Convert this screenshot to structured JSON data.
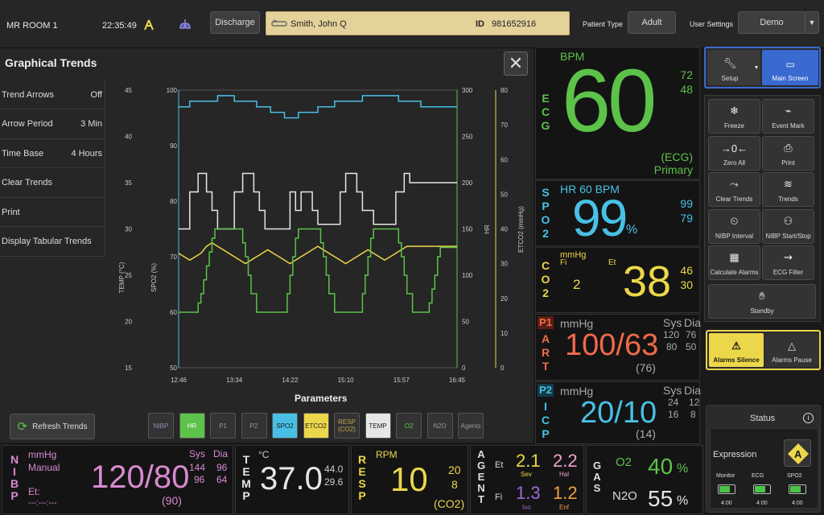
{
  "topbar": {
    "room": "MR ROOM 1",
    "time": "22:35:49",
    "discharge_label": "Discharge",
    "patient_name": "Smith, John Q",
    "id_label": "ID",
    "patient_id": "981652916",
    "patient_type_label": "Patient Type",
    "patient_type_value": "Adult",
    "user_settings_label": "User Settings",
    "user_settings_value": "Demo"
  },
  "trends": {
    "title": "Graphical Trends",
    "menu": [
      {
        "label": "Trend Arrows",
        "value": "Off"
      },
      {
        "label": "Arrow Period",
        "value": "3 Min"
      },
      {
        "label": "Time Base",
        "value": "4 Hours"
      },
      {
        "label": "Clear Trends",
        "value": ""
      },
      {
        "label": "Print",
        "value": ""
      },
      {
        "label": "Display Tabular Trends",
        "value": ""
      }
    ],
    "parameters_label": "Parameters",
    "refresh_label": "Refresh Trends",
    "params": [
      {
        "label": "NIBP",
        "bg": "#333333",
        "fg": "#a08ab0"
      },
      {
        "label": "HR",
        "bg": "#5cc24a",
        "fg": "#ffffff"
      },
      {
        "label": "P1",
        "bg": "#333333",
        "fg": "#999999"
      },
      {
        "label": "P2",
        "bg": "#333333",
        "fg": "#999999"
      },
      {
        "label": "SPO2",
        "bg": "#48c0e6",
        "fg": "#1a1a1a"
      },
      {
        "label": "ETCO2",
        "bg": "#ecd74a",
        "fg": "#1a1a1a"
      },
      {
        "label": "RESP (CO2)",
        "bg": "#333333",
        "fg": "#c2a84a"
      },
      {
        "label": "TEMP",
        "bg": "#e6e6e6",
        "fg": "#1a1a1a"
      },
      {
        "label": "O2",
        "bg": "#333333",
        "fg": "#5cc24a"
      },
      {
        "label": "N2O",
        "bg": "#333333",
        "fg": "#999999"
      },
      {
        "label": "Agents",
        "bg": "#333333",
        "fg": "#999999"
      }
    ]
  },
  "chart_data": {
    "type": "line",
    "x_ticks": [
      "12:46",
      "13:34",
      "14:22",
      "15:10",
      "15:57",
      "16:45"
    ],
    "axes": {
      "temp": {
        "label": "TEMP (°C)",
        "range": [
          15,
          45
        ],
        "ticks": [
          "15",
          "20",
          "25",
          "30",
          "35",
          "40",
          "45"
        ]
      },
      "spo2": {
        "label": "SPO2 (%)",
        "range": [
          50,
          100
        ],
        "ticks": [
          "50",
          "60",
          "70",
          "80",
          "90",
          "100"
        ]
      },
      "hr": {
        "label": "HR",
        "range": [
          0,
          300
        ],
        "ticks": [
          "0",
          "50",
          "100",
          "150",
          "200",
          "250",
          "300"
        ]
      },
      "etco2": {
        "label": "ETCO2 (mmHg)",
        "range": [
          0,
          80
        ],
        "ticks": [
          "0",
          "10",
          "20",
          "30",
          "40",
          "50",
          "60",
          "70",
          "80"
        ]
      }
    },
    "series": [
      {
        "axis": "spo2",
        "color": "#48c0e6",
        "points": [
          [
            0,
            97
          ],
          [
            0.04,
            97
          ],
          [
            0.04,
            98
          ],
          [
            0.14,
            98
          ],
          [
            0.14,
            99
          ],
          [
            0.2,
            99
          ],
          [
            0.2,
            98
          ],
          [
            0.28,
            98
          ],
          [
            0.28,
            97
          ],
          [
            0.33,
            97
          ],
          [
            0.33,
            96
          ],
          [
            0.38,
            96
          ],
          [
            0.38,
            95
          ],
          [
            0.43,
            95
          ],
          [
            0.43,
            96
          ],
          [
            0.5,
            96
          ],
          [
            0.5,
            97
          ],
          [
            0.56,
            97
          ],
          [
            0.56,
            98
          ],
          [
            0.66,
            98
          ],
          [
            0.66,
            99
          ],
          [
            0.79,
            99
          ],
          [
            0.79,
            98
          ],
          [
            0.87,
            98
          ],
          [
            0.87,
            97
          ],
          [
            1,
            97
          ]
        ]
      },
      {
        "axis": "temp",
        "color": "#e6e6e6",
        "points": [
          [
            0,
            30
          ],
          [
            0.04,
            30
          ],
          [
            0.04,
            34
          ],
          [
            0.07,
            34
          ],
          [
            0.07,
            36
          ],
          [
            0.1,
            36
          ],
          [
            0.1,
            34
          ],
          [
            0.12,
            34
          ],
          [
            0.12,
            32
          ],
          [
            0.14,
            32
          ],
          [
            0.14,
            30
          ],
          [
            0.2,
            30
          ],
          [
            0.2,
            34
          ],
          [
            0.23,
            34
          ],
          [
            0.23,
            36
          ],
          [
            0.27,
            36
          ],
          [
            0.27,
            34
          ],
          [
            0.29,
            34
          ],
          [
            0.29,
            32
          ],
          [
            0.31,
            32
          ],
          [
            0.31,
            30
          ],
          [
            0.4,
            30
          ],
          [
            0.4,
            34
          ],
          [
            0.42,
            34
          ],
          [
            0.42,
            32
          ],
          [
            0.44,
            32
          ],
          [
            0.44,
            34
          ],
          [
            0.48,
            34
          ],
          [
            0.48,
            32
          ],
          [
            0.5,
            32
          ],
          [
            0.5,
            30.5
          ],
          [
            0.58,
            30.5
          ],
          [
            0.58,
            34
          ],
          [
            0.6,
            34
          ],
          [
            0.6,
            36
          ],
          [
            0.64,
            36
          ],
          [
            0.64,
            34
          ],
          [
            0.66,
            34
          ],
          [
            0.66,
            32
          ],
          [
            0.7,
            32
          ],
          [
            0.7,
            30.5
          ],
          [
            0.78,
            30.5
          ],
          [
            0.78,
            34
          ],
          [
            0.81,
            34
          ],
          [
            0.81,
            36
          ],
          [
            0.83,
            36
          ],
          [
            0.83,
            35
          ],
          [
            1,
            35
          ]
        ]
      },
      {
        "axis": "etco2",
        "color": "#ecd74a",
        "points": [
          [
            0,
            33
          ],
          [
            0.02,
            32
          ],
          [
            0.04,
            31
          ],
          [
            0.06,
            32
          ],
          [
            0.08,
            33
          ],
          [
            0.1,
            35
          ],
          [
            0.12,
            36
          ],
          [
            0.14,
            35
          ],
          [
            0.16,
            34
          ],
          [
            0.18,
            33
          ],
          [
            0.2,
            32
          ],
          [
            0.22,
            31
          ],
          [
            0.24,
            30
          ],
          [
            0.26,
            31
          ],
          [
            0.28,
            32
          ],
          [
            0.3,
            33
          ],
          [
            0.32,
            34
          ],
          [
            0.34,
            33
          ],
          [
            0.36,
            32
          ],
          [
            0.38,
            31
          ],
          [
            0.4,
            30
          ],
          [
            0.42,
            31
          ],
          [
            0.44,
            32
          ],
          [
            0.46,
            33
          ],
          [
            0.48,
            34
          ],
          [
            0.5,
            35
          ],
          [
            0.52,
            34
          ],
          [
            0.54,
            33
          ],
          [
            0.56,
            32
          ],
          [
            0.58,
            31
          ],
          [
            0.6,
            30
          ],
          [
            0.62,
            31
          ],
          [
            0.64,
            32
          ],
          [
            0.66,
            33
          ],
          [
            0.68,
            34
          ],
          [
            0.7,
            33
          ],
          [
            0.72,
            32
          ],
          [
            0.74,
            31
          ],
          [
            0.76,
            32
          ],
          [
            0.78,
            33
          ],
          [
            0.8,
            34
          ],
          [
            0.82,
            35
          ],
          [
            0.85,
            35
          ],
          [
            1,
            35
          ]
        ]
      },
      {
        "axis": "hr",
        "color": "#5cc24a",
        "points": [
          [
            0,
            60
          ],
          [
            0.07,
            60
          ],
          [
            0.07,
            70
          ],
          [
            0.08,
            70
          ],
          [
            0.08,
            80
          ],
          [
            0.09,
            80
          ],
          [
            0.09,
            95
          ],
          [
            0.1,
            95
          ],
          [
            0.1,
            110
          ],
          [
            0.11,
            110
          ],
          [
            0.11,
            125
          ],
          [
            0.12,
            125
          ],
          [
            0.12,
            140
          ],
          [
            0.13,
            140
          ],
          [
            0.13,
            150
          ],
          [
            0.23,
            150
          ],
          [
            0.23,
            135
          ],
          [
            0.24,
            135
          ],
          [
            0.24,
            120
          ],
          [
            0.25,
            120
          ],
          [
            0.25,
            100
          ],
          [
            0.26,
            100
          ],
          [
            0.26,
            80
          ],
          [
            0.28,
            80
          ],
          [
            0.28,
            60
          ],
          [
            0.39,
            60
          ],
          [
            0.39,
            80
          ],
          [
            0.4,
            80
          ],
          [
            0.4,
            100
          ],
          [
            0.41,
            100
          ],
          [
            0.41,
            120
          ],
          [
            0.42,
            120
          ],
          [
            0.42,
            140
          ],
          [
            0.43,
            140
          ],
          [
            0.43,
            150
          ],
          [
            0.51,
            150
          ],
          [
            0.51,
            135
          ],
          [
            0.52,
            135
          ],
          [
            0.52,
            120
          ],
          [
            0.53,
            120
          ],
          [
            0.53,
            100
          ],
          [
            0.54,
            100
          ],
          [
            0.54,
            80
          ],
          [
            0.56,
            80
          ],
          [
            0.56,
            60
          ],
          [
            0.66,
            60
          ],
          [
            0.66,
            80
          ],
          [
            0.67,
            80
          ],
          [
            0.67,
            100
          ],
          [
            0.68,
            100
          ],
          [
            0.68,
            120
          ],
          [
            0.69,
            120
          ],
          [
            0.69,
            140
          ],
          [
            0.7,
            140
          ],
          [
            0.7,
            150
          ],
          [
            0.79,
            150
          ],
          [
            0.79,
            135
          ],
          [
            0.8,
            135
          ],
          [
            0.8,
            120
          ],
          [
            0.81,
            120
          ],
          [
            0.81,
            100
          ],
          [
            0.82,
            100
          ],
          [
            0.82,
            80
          ],
          [
            0.84,
            80
          ],
          [
            0.84,
            60
          ],
          [
            0.9,
            60
          ],
          [
            0.9,
            70
          ],
          [
            0.91,
            70
          ],
          [
            0.91,
            85
          ],
          [
            0.92,
            85
          ],
          [
            0.92,
            100
          ],
          [
            0.93,
            100
          ],
          [
            0.93,
            120
          ],
          [
            0.94,
            120
          ],
          [
            0.94,
            130
          ],
          [
            1,
            130
          ]
        ]
      }
    ]
  },
  "vitals": {
    "ecg": {
      "label": "ECG",
      "unit": "BPM",
      "value": "60",
      "upper": "72",
      "lower": "48",
      "source": "(ECG)",
      "lead": "Primary",
      "color": "#5cc24a"
    },
    "spo2": {
      "label": "SPO2",
      "unit": "HR 60 BPM",
      "value": "99",
      "percent": "%",
      "upper": "99",
      "lower": "79",
      "color": "#48c0e6"
    },
    "co2": {
      "label": "CO2",
      "unit": "mmHg",
      "fi_label": "Fi",
      "fi_value": "2",
      "et_label": "Et",
      "value": "38",
      "upper": "46",
      "lower": "30",
      "color": "#ecd74a"
    },
    "art": {
      "tag": "P1",
      "label": "ART",
      "unit": "mmHg",
      "value": "100/63",
      "mean": "(76)",
      "sys_label": "Sys",
      "dia_label": "Dia",
      "sys_hi": "120",
      "dia_hi": "76",
      "sys_lo": "80",
      "dia_lo": "50",
      "color": "#f06a4a"
    },
    "icp": {
      "tag": "P2",
      "label": "ICP",
      "unit": "mmHg",
      "value": "20/10",
      "mean": "(14)",
      "sys_label": "Sys",
      "dia_label": "Dia",
      "sys_hi": "24",
      "dia_hi": "12",
      "sys_lo": "16",
      "dia_lo": "8",
      "color": "#48c0e6"
    }
  },
  "controls": {
    "setup": "Setup",
    "main_screen": "Main Screen",
    "buttons": [
      {
        "label": "Freeze",
        "icon": "❄"
      },
      {
        "label": "Event Mark",
        "icon": "⌁"
      },
      {
        "label": "Zero All",
        "icon": "→0←"
      },
      {
        "label": "Print",
        "icon": "⎙"
      },
      {
        "label": "Clear Trends",
        "icon": "⤳"
      },
      {
        "label": "Trends",
        "icon": "≋"
      },
      {
        "label": "NIBP Interval",
        "icon": "⏲"
      },
      {
        "label": "NIBP Start/Stop",
        "icon": "⚇"
      },
      {
        "label": "Calculate Alarms",
        "icon": "▦"
      },
      {
        "label": "ECG Filter",
        "icon": "⇝"
      }
    ],
    "standby": "Standby",
    "alarms_silence": "Alarms Silence",
    "alarms_pause": "Alarms Pause"
  },
  "status": {
    "title": "Status",
    "expression": "Expression",
    "expression_letter": "A",
    "batteries": [
      {
        "label": "Monitor",
        "time": "4:00",
        "level": 0.7
      },
      {
        "label": "ECG",
        "time": "4:00",
        "level": 0.7
      },
      {
        "label": "SPO2",
        "time": "4:00",
        "level": 0.7
      }
    ]
  },
  "bottom": {
    "nibp": {
      "label": "NIBP",
      "unit": "mmHg",
      "mode": "Manual",
      "value": "120/80",
      "mean": "(90)",
      "et_label": "Et:",
      "et_value": "---:---:---",
      "sys_label": "Sys",
      "dia_label": "Dia",
      "sys_hi": "144",
      "dia_hi": "96",
      "sys_lo": "96",
      "dia_lo": "64",
      "color": "#d88ad0"
    },
    "temp": {
      "label": "TEMP",
      "unit": "°C",
      "value": "37.0",
      "upper": "44.0",
      "lower": "29.6",
      "color": "#e6e6e6"
    },
    "resp": {
      "label": "RESP",
      "unit": "RPM",
      "value": "10",
      "upper": "20",
      "lower": "8",
      "source": "(CO2)",
      "color": "#ecd74a"
    },
    "agent": {
      "label": "AGENT",
      "et_label": "Et",
      "fi_label": "Fi",
      "sev_et": "2.1",
      "sev": "Sev",
      "hal_et": "2.2",
      "hal": "Hal",
      "iso_fi": "1.3",
      "iso": "Iso",
      "enf_fi": "1.2",
      "enf": "Enf"
    },
    "gas": {
      "label": "GAS",
      "o2_label": "O2",
      "o2_value": "40",
      "n2o_label": "N2O",
      "n2o_value": "55",
      "percent": "%"
    }
  }
}
